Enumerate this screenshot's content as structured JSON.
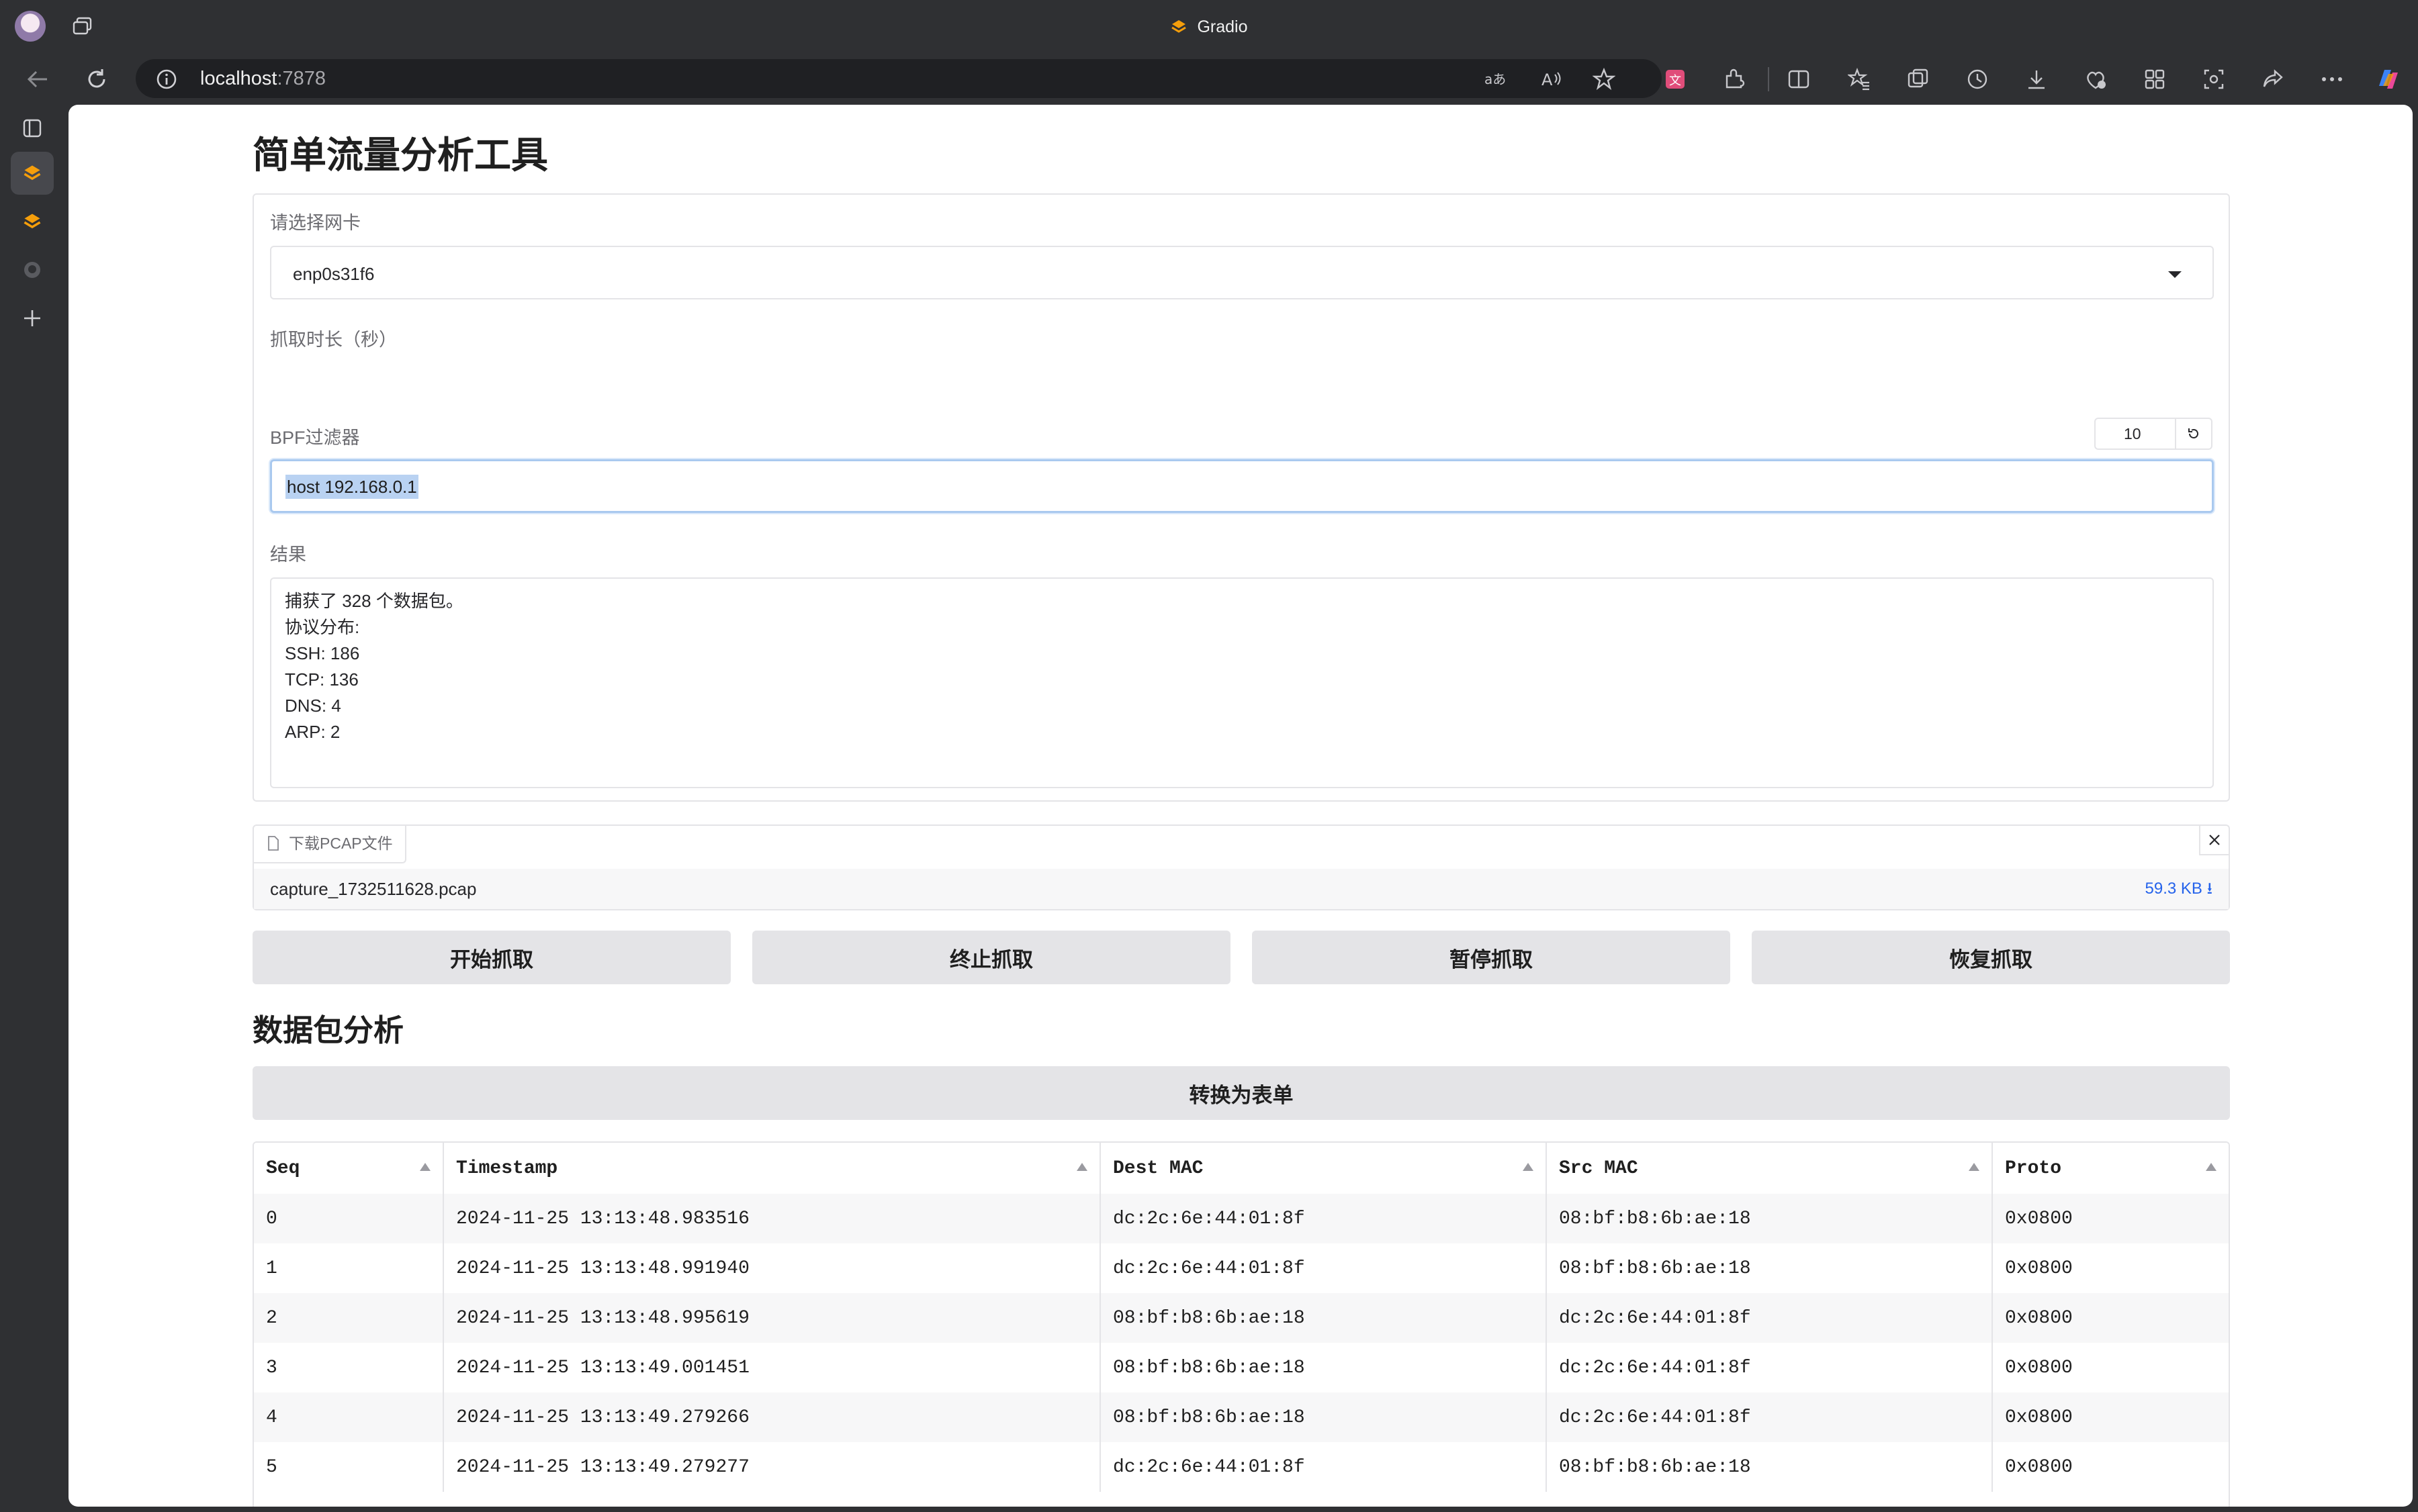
{
  "browser": {
    "tab_title": "Gradio",
    "url_host": "localhost",
    "url_port": ":7878"
  },
  "app": {
    "title": "简单流量分析工具",
    "nic": {
      "label": "请选择网卡",
      "value": "enp0s31f6"
    },
    "duration": {
      "label": "抓取时长（秒）",
      "value": "10",
      "min": "1",
      "max": "60",
      "fraction": 0.153
    },
    "bpf": {
      "label": "BPF过滤器",
      "value": "host 192.168.0.1"
    },
    "result": {
      "label": "结果",
      "lines": [
        "捕获了 328 个数据包。",
        "协议分布:",
        "SSH: 186",
        "TCP: 136",
        "DNS: 4",
        "ARP: 2"
      ]
    },
    "download": {
      "label": "下载PCAP文件",
      "file_name": "capture_1732511628.pcap",
      "file_size": "59.3 KB ⭳"
    },
    "buttons": {
      "start": "开始抓取",
      "stop": "终止抓取",
      "pause": "暂停抓取",
      "resume": "恢复抓取"
    },
    "section_title": "数据包分析",
    "convert_button": "转换为表单",
    "table": {
      "columns": [
        "Seq",
        "Timestamp",
        "Dest MAC",
        "Src MAC",
        "Proto"
      ],
      "rows": [
        [
          "0",
          "2024-11-25 13:13:48.983516",
          "dc:2c:6e:44:01:8f",
          "08:bf:b8:6b:ae:18",
          "0x0800"
        ],
        [
          "1",
          "2024-11-25 13:13:48.991940",
          "dc:2c:6e:44:01:8f",
          "08:bf:b8:6b:ae:18",
          "0x0800"
        ],
        [
          "2",
          "2024-11-25 13:13:48.995619",
          "08:bf:b8:6b:ae:18",
          "dc:2c:6e:44:01:8f",
          "0x0800"
        ],
        [
          "3",
          "2024-11-25 13:13:49.001451",
          "08:bf:b8:6b:ae:18",
          "dc:2c:6e:44:01:8f",
          "0x0800"
        ],
        [
          "4",
          "2024-11-25 13:13:49.279266",
          "08:bf:b8:6b:ae:18",
          "dc:2c:6e:44:01:8f",
          "0x0800"
        ],
        [
          "5",
          "2024-11-25 13:13:49.279277",
          "dc:2c:6e:44:01:8f",
          "08:bf:b8:6b:ae:18",
          "0x0800"
        ]
      ]
    }
  },
  "colors": {
    "accent": "#e97537",
    "link": "#2563eb",
    "button_bg": "#e4e4e7",
    "chrome_bg": "#2f3033"
  }
}
